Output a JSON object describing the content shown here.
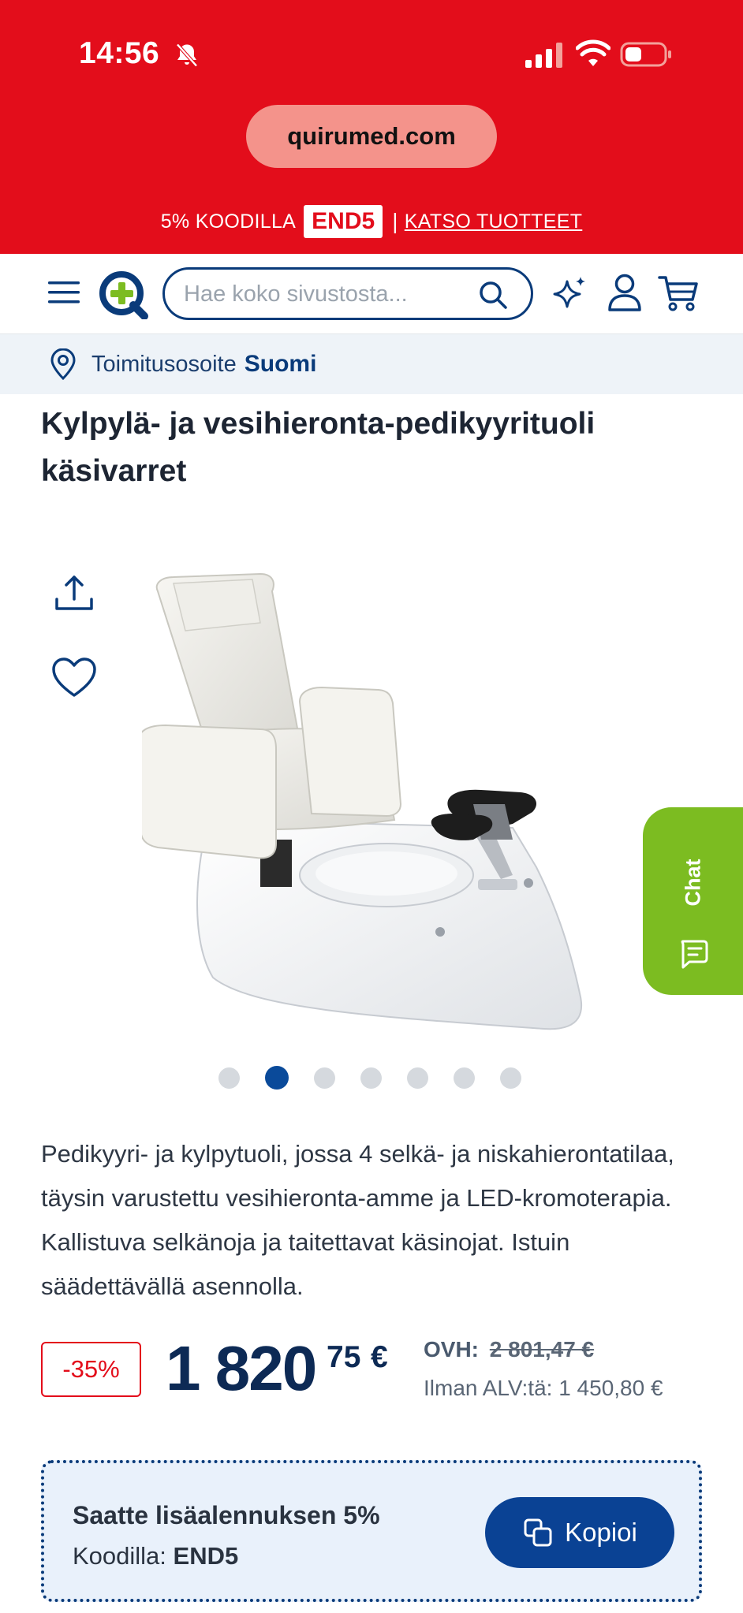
{
  "status_bar": {
    "time": "14:56"
  },
  "browser": {
    "url": "quirumed.com"
  },
  "promo_banner": {
    "prefix": "5% KOODILLA",
    "code": "END5",
    "separator": "|",
    "link": "KATSO TUOTTEET"
  },
  "header": {
    "search_placeholder": "Hae koko sivustosta..."
  },
  "delivery": {
    "label": "Toimitusosoite",
    "country": "Suomi"
  },
  "product": {
    "title": "Kylpylä- ja vesihieronta-pedikyyrituoli käsivarret",
    "description": "Pedikyyri- ja kylpytuoli, jossa 4 selkä- ja niskahierontatilaa, täysin varustettu vesihieronta-amme ja LED-kromoterapia. Kallistuva selkänoja ja taitettavat käsinojat. Istuin säädettävällä asennolla.",
    "gallery": {
      "count": 7,
      "active_index": 1
    }
  },
  "chat": {
    "label": "Chat"
  },
  "price": {
    "discount": "-35%",
    "main": "1 820",
    "cents": "75",
    "currency": "€",
    "ovh_label": "OVH:",
    "ovh_value": "2 801,47 €",
    "net_text": "Ilman ALV:tä: 1 450,80 €"
  },
  "coupon": {
    "title": "Saatte lisäalennuksen 5%",
    "code_label": "Koodilla:",
    "code": "END5",
    "button": "Kopioi"
  },
  "colors": {
    "brand_red": "#e30d1b",
    "navy": "#0a3b7a",
    "chat_green": "#7cbc21"
  }
}
